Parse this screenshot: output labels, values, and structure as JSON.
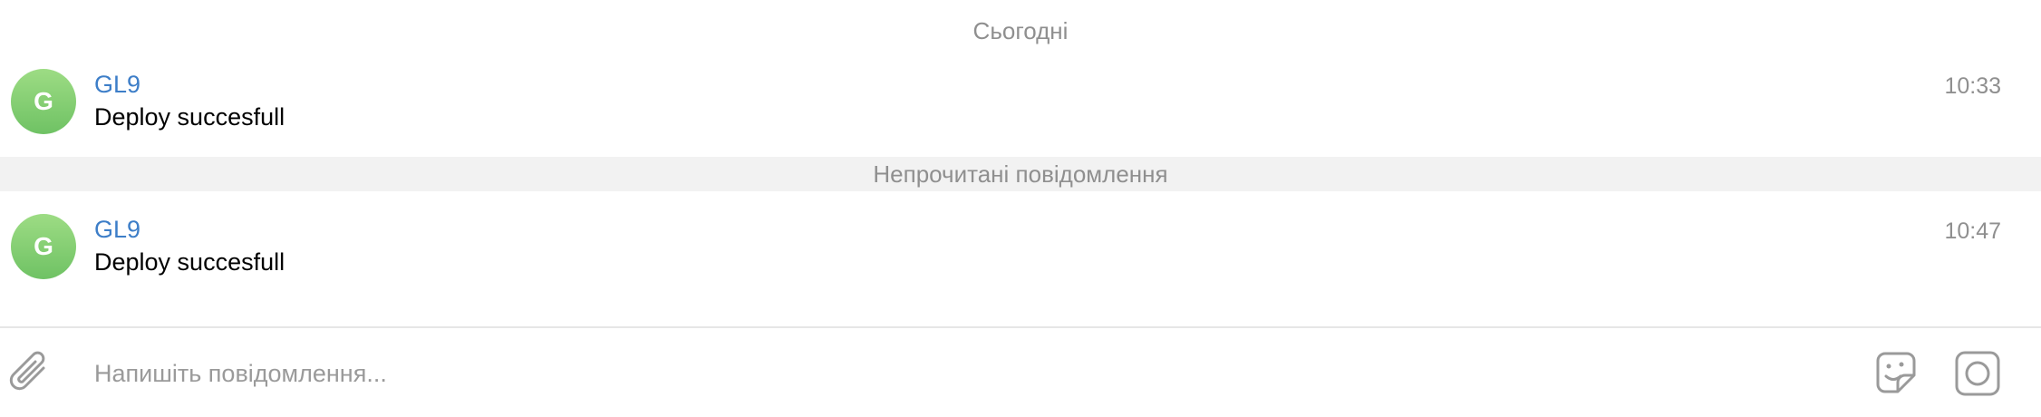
{
  "date_separator": "Сьогодні",
  "unread_separator": "Непрочитані повідомлення",
  "messages": [
    {
      "avatar_letter": "G",
      "sender": "GL9",
      "text": "Deploy succesfull",
      "time": "10:33"
    },
    {
      "avatar_letter": "G",
      "sender": "GL9",
      "text": "Deploy succesfull",
      "time": "10:47"
    }
  ],
  "composer": {
    "placeholder": "Напишіть повідомлення...",
    "value": "",
    "attach_icon": "paperclip-icon",
    "sticker_icon": "sticker-icon",
    "camera_icon": "camera-icon"
  },
  "colors": {
    "sender": "#3d7ec8",
    "avatar": "#7fcc6e",
    "muted": "#8f8f8f",
    "unread_bg": "#f2f2f2"
  }
}
